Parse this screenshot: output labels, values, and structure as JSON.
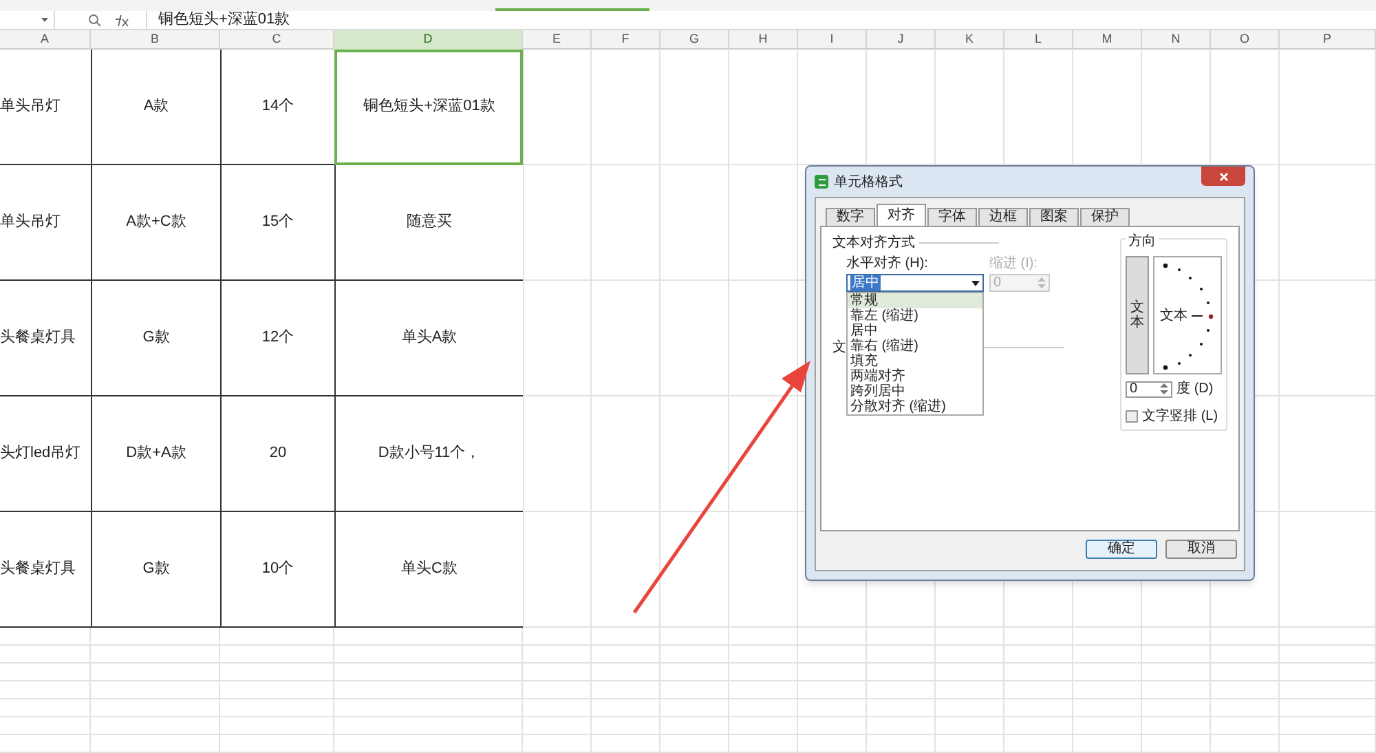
{
  "formula_bar": {
    "value": "铜色短头+深蓝01款"
  },
  "columns": [
    {
      "label": "A",
      "selected": false
    },
    {
      "label": "B",
      "selected": false
    },
    {
      "label": "C",
      "selected": false
    },
    {
      "label": "D",
      "selected": true
    },
    {
      "label": "E",
      "selected": false
    },
    {
      "label": "F",
      "selected": false
    },
    {
      "label": "G",
      "selected": false
    },
    {
      "label": "H",
      "selected": false
    },
    {
      "label": "I",
      "selected": false
    },
    {
      "label": "J",
      "selected": false
    },
    {
      "label": "K",
      "selected": false
    },
    {
      "label": "L",
      "selected": false
    },
    {
      "label": "M",
      "selected": false
    },
    {
      "label": "N",
      "selected": false
    },
    {
      "label": "O",
      "selected": false
    },
    {
      "label": "P",
      "selected": false
    }
  ],
  "rows": [
    {
      "cells": [
        "单头吊灯",
        "A款",
        "14个",
        "铜色短头+深蓝01款"
      ]
    },
    {
      "cells": [
        "单头吊灯",
        "A款+C款",
        "15个",
        "随意买"
      ]
    },
    {
      "cells": [
        "头餐桌灯具",
        "G款",
        "12个",
        "单头A款"
      ]
    },
    {
      "cells": [
        "头灯led吊灯",
        "D款+A款",
        "20",
        "D款小号11个，"
      ]
    },
    {
      "cells": [
        "头餐桌灯具",
        "G款",
        "10个",
        "单头C款"
      ]
    }
  ],
  "dialog": {
    "title": "单元格格式",
    "tabs": [
      {
        "label": "数字",
        "selected": false
      },
      {
        "label": "对齐",
        "selected": true
      },
      {
        "label": "字体",
        "selected": false
      },
      {
        "label": "边框",
        "selected": false
      },
      {
        "label": "图案",
        "selected": false
      },
      {
        "label": "保护",
        "selected": false
      }
    ],
    "alignment_group": "文本对齐方式",
    "horizontal_label": "水平对齐 (H):",
    "horizontal_value": "居中",
    "horizontal_options": [
      {
        "label": "常规",
        "selected": true
      },
      {
        "label": "靠左 (缩进)",
        "selected": false
      },
      {
        "label": "居中",
        "selected": false
      },
      {
        "label": "靠右 (缩进)",
        "selected": false
      },
      {
        "label": "填充",
        "selected": false
      },
      {
        "label": "两端对齐",
        "selected": false
      },
      {
        "label": "跨列居中",
        "selected": false
      },
      {
        "label": "分散对齐 (缩进)",
        "selected": false
      }
    ],
    "partial_group_label": "文",
    "indent_label": "缩进 (I):",
    "indent_value": "0",
    "indent_disabled": true,
    "orientation": {
      "title": "方向",
      "vertical_text": "文本",
      "dial_text": "文本",
      "degree_value": "0",
      "degree_label": "度 (D)",
      "stacked_label": "文字竖排 (L)",
      "stacked_checked": false
    },
    "buttons": [
      "确定",
      "取消"
    ]
  }
}
